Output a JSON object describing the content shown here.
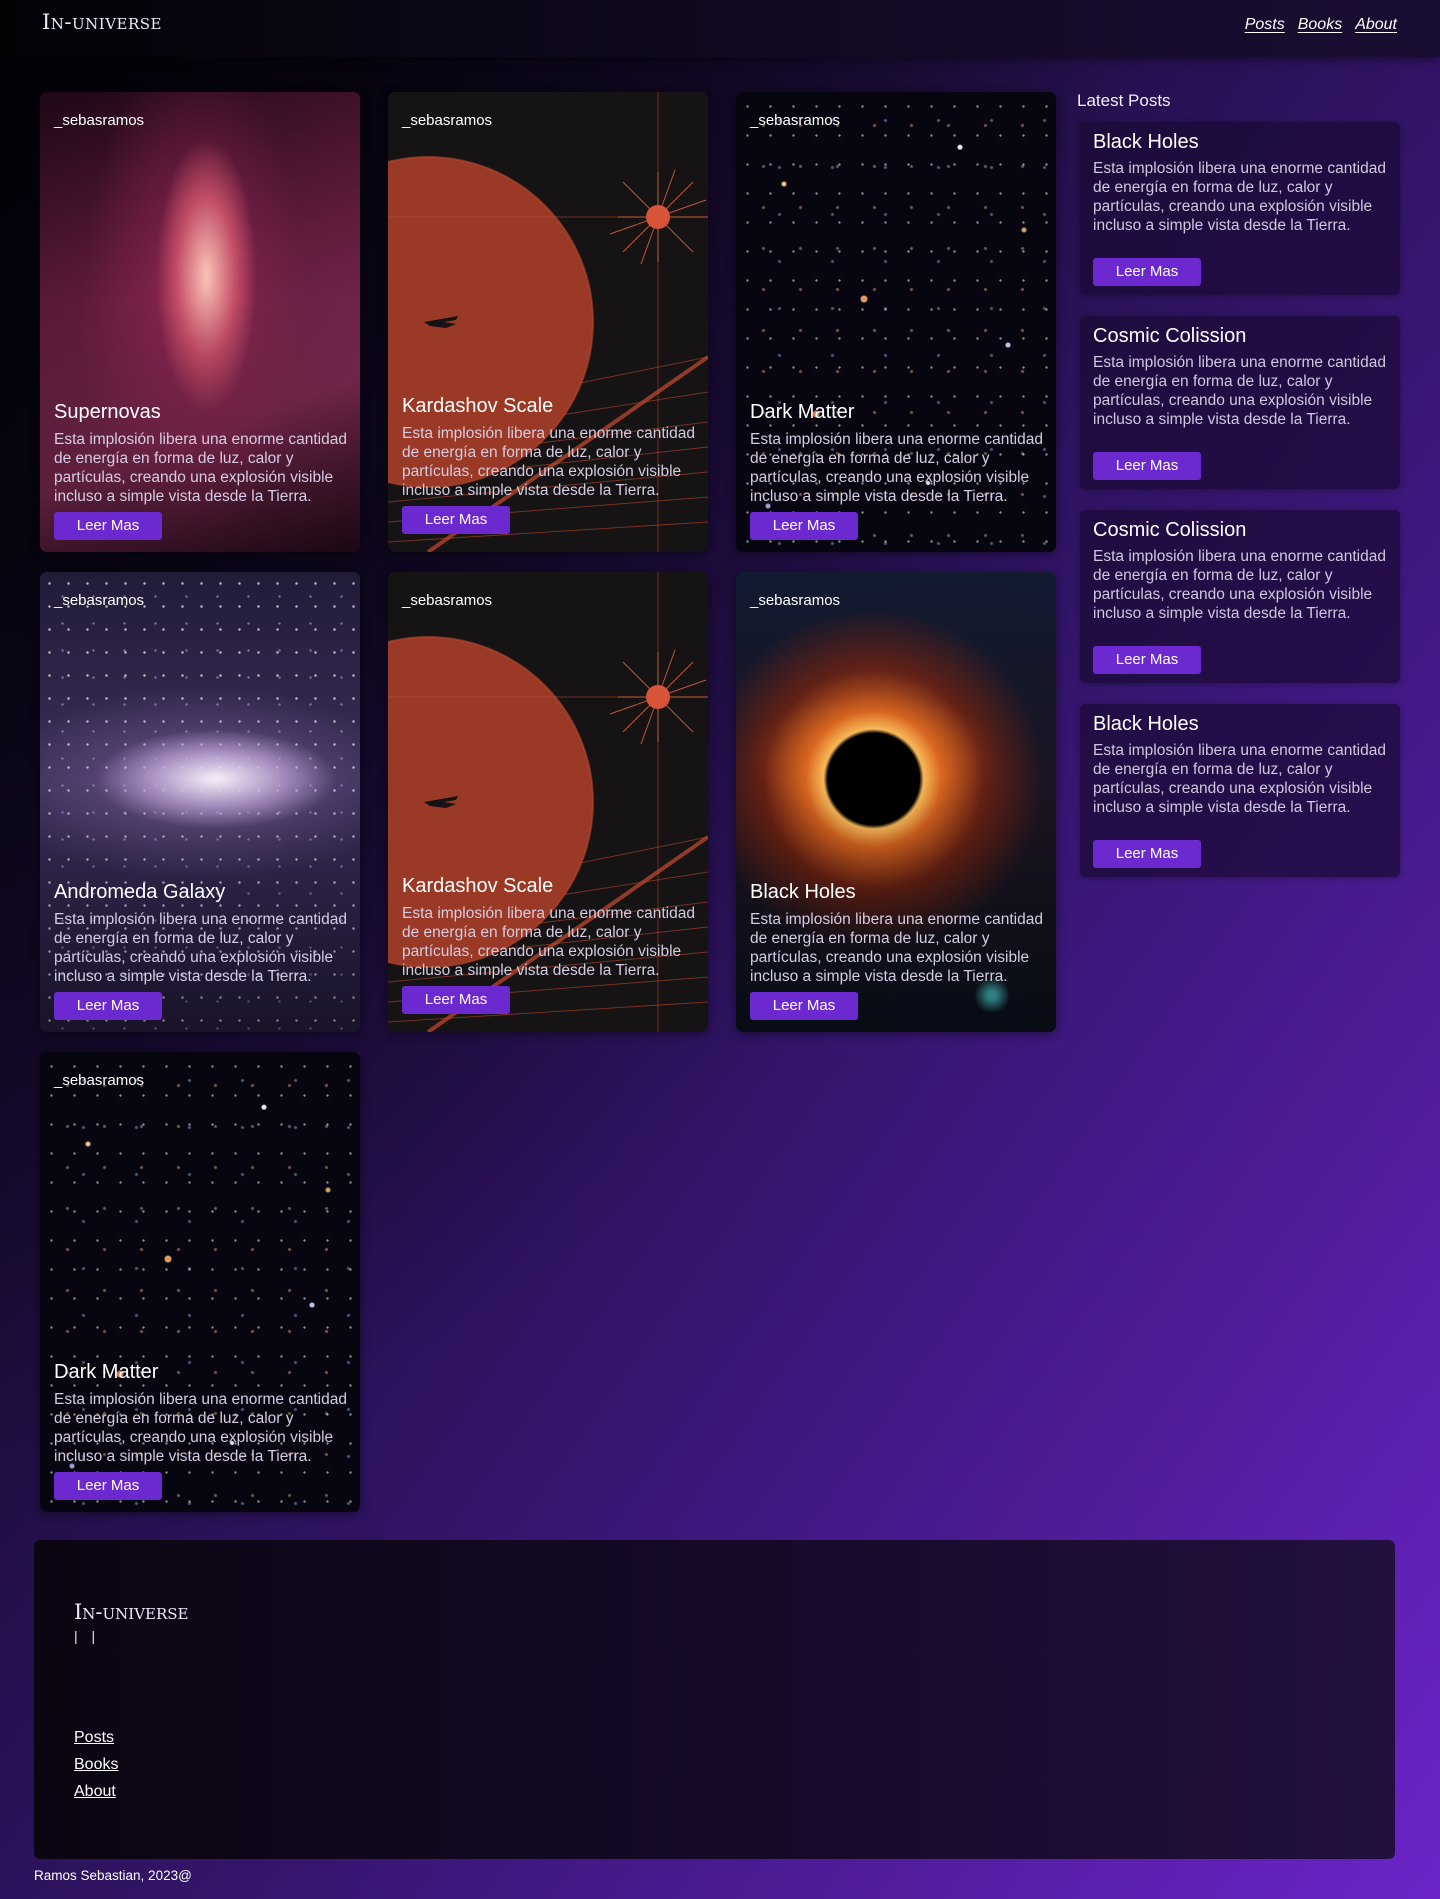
{
  "header": {
    "logo": "In-universe",
    "nav": [
      "Posts",
      "Books",
      "About"
    ]
  },
  "cards": [
    {
      "author": "_sebasramos",
      "title": "Supernovas",
      "text": "Esta implosión libera una enorme cantidad de energía en forma de luz, calor y partículas, creando una explosión visible incluso a simple vista desde la Tierra.",
      "button": "Leer Mas"
    },
    {
      "author": "_sebasramos",
      "title": "Kardashov Scale",
      "text": "Esta implosión libera una enorme cantidad de energía en forma de luz, calor y partículas, creando una explosión visible incluso a simple vista desde la Tierra.",
      "button": "Leer Mas"
    },
    {
      "author": "_sebasramos",
      "title": "Dark Matter",
      "text": "Esta implosión libera una enorme cantidad de energía en forma de luz, calor y partículas, creando una explosión visible incluso a simple vista desde la Tierra.",
      "button": "Leer Mas"
    },
    {
      "author": "_sebasramos",
      "title": "Andromeda Galaxy",
      "text": "Esta implosión libera una enorme cantidad de energía en forma de luz, calor y partículas, creando una explosión visible incluso a simple vista desde la Tierra.",
      "button": "Leer Mas"
    },
    {
      "author": "_sebasramos",
      "title": "Kardashov Scale",
      "text": "Esta implosión libera una enorme cantidad de energía en forma de luz, calor y partículas, creando una explosión visible incluso a simple vista desde la Tierra.",
      "button": "Leer Mas"
    },
    {
      "author": "_sebasramos",
      "title": "Black Holes",
      "text": "Esta implosión libera una enorme cantidad de energía en forma de luz, calor y partículas, creando una explosión visible incluso a simple vista desde la Tierra.",
      "button": "Leer Mas"
    },
    {
      "author": "_sebasramos",
      "title": "Dark Matter",
      "text": "Esta implosión libera una enorme cantidad de energía en forma de luz, calor y partículas, creando una explosión visible incluso a simple vista desde la Tierra.",
      "button": "Leer Mas"
    }
  ],
  "sidebar": {
    "title": "Latest Posts",
    "posts": [
      {
        "title": "Black Holes",
        "text": "Esta implosión libera una enorme cantidad de energía en forma de luz, calor y partículas, creando una explosión visible incluso a simple vista desde la Tierra.",
        "button": "Leer Mas"
      },
      {
        "title": "Cosmic Colission",
        "text": "Esta implosión libera una enorme cantidad de energía en forma de luz, calor y partículas, creando una explosión visible incluso a simple vista desde la Tierra.",
        "button": "Leer Mas"
      },
      {
        "title": "Cosmic Colission",
        "text": "Esta implosión libera una enorme cantidad de energía en forma de luz, calor y partículas, creando una explosión visible incluso a simple vista desde la Tierra.",
        "button": "Leer Mas"
      },
      {
        "title": "Black Holes",
        "text": "Esta implosión libera una enorme cantidad de energía en forma de luz, calor y partículas, creando una explosión visible incluso a simple vista desde la Tierra.",
        "button": "Leer Mas"
      }
    ]
  },
  "footer": {
    "logo": "In-universe",
    "bars": "| |",
    "links": [
      "Posts",
      "Books",
      "About"
    ],
    "copyright": "Ramos Sebastian, 2023@"
  },
  "colors": {
    "accent": "#6d29d0",
    "background_dark": "#040309",
    "background_light": "#6c24c9",
    "card_panel": "#1a0a34"
  },
  "icons": [
    "planet-illustration",
    "spaceship-icon",
    "starburst-icon"
  ]
}
